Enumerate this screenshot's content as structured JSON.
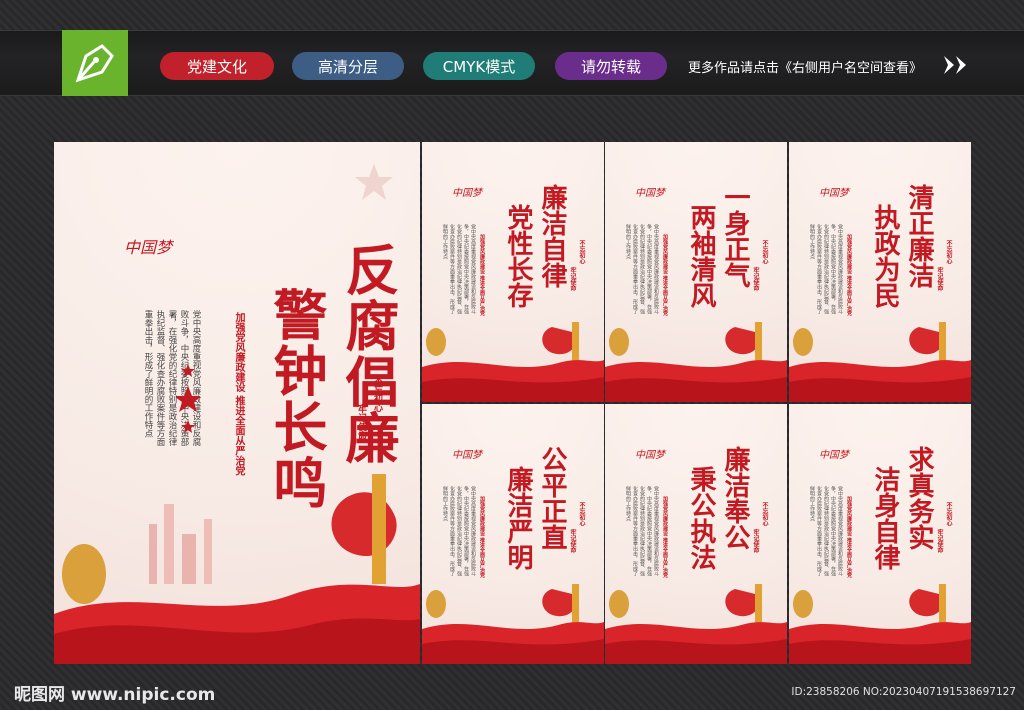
{
  "toolbar": {
    "tags": [
      "党建文化",
      "高清分层",
      "CMYK模式",
      "请勿转载"
    ],
    "more_text": "更多作品请点击《右侧用户名空间查看》"
  },
  "main_poster": {
    "logo_text": "中国梦",
    "title_line1": "反腐倡廉",
    "title_line2": "警钟长鸣",
    "subtitle": "加强党风廉政建设 推进全面从严治党",
    "body": "党中央高度重视党风廉政建设和反腐败斗争，中央纪委按照党中央决策部署，在强化党的纪律特别是政治纪律执纪监督、强化查办腐败案件等方面重拳出击，形成了鲜明的工作特点",
    "seal_1": "不忘初心",
    "seal_2": "牢记使命"
  },
  "small_posters": [
    {
      "line1": "廉洁自律",
      "line2": "党性长存"
    },
    {
      "line1": "一身正气",
      "line2": "两袖清风"
    },
    {
      "line1": "清正廉洁",
      "line2": "执政为民"
    },
    {
      "line1": "公平正直",
      "line2": "廉洁严明"
    },
    {
      "line1": "廉洁奉公",
      "line2": "秉公执法"
    },
    {
      "line1": "求真务实",
      "line2": "洁身自律"
    }
  ],
  "footer": {
    "site": "昵图网 www.nipic.com",
    "id_text": "ID:23858206 NO:20230407191538697127"
  },
  "colors": {
    "brand_red": "#c21a22",
    "logo_green": "#6ab42d"
  }
}
